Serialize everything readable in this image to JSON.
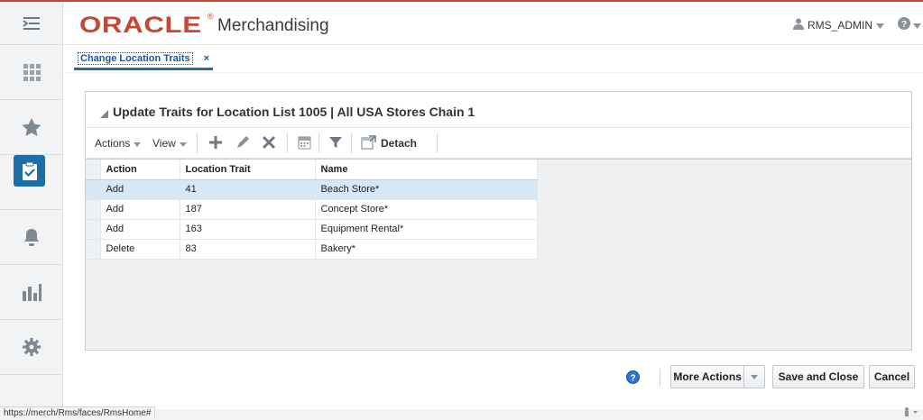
{
  "app": {
    "brand": "ORACLE",
    "reg_mark": "®",
    "name": "Merchandising"
  },
  "user": {
    "name": "RMS_ADMIN"
  },
  "tabs": [
    {
      "label": "Change Location Traits",
      "close": "×"
    }
  ],
  "panel": {
    "title": "Update Traits for Location List 1005 | All USA Stores Chain 1",
    "toolbar": {
      "actions": "Actions",
      "view": "View",
      "detach": "Detach"
    },
    "table": {
      "columns": [
        "Action",
        "Location Trait",
        "Name"
      ],
      "rows": [
        [
          "Add",
          "41",
          "Beach Store*"
        ],
        [
          "Add",
          "187",
          "Concept Store*"
        ],
        [
          "Add",
          "163",
          "Equipment Rental*"
        ],
        [
          "Delete",
          "83",
          "Bakery*"
        ]
      ],
      "selected_row": 0
    }
  },
  "footer": {
    "more_actions": "More Actions",
    "save_close": "Save and Close",
    "cancel": "Cancel"
  },
  "status_bar": {
    "url": "https://merch/Rms/faces/RmsHome#"
  },
  "colors": {
    "brand": "#c74634",
    "accent": "#1e6ea6",
    "selected_row": "#d6e7f6"
  },
  "icons": {
    "rail": [
      "tasks-menu-icon",
      "grid-icon",
      "star-icon",
      "clipboard-check-icon",
      "bell-icon",
      "bar-chart-icon",
      "gear-icon"
    ],
    "toolbar": [
      "add-icon",
      "edit-icon",
      "delete-icon",
      "calendar-icon",
      "filter-icon",
      "detach-icon"
    ]
  }
}
